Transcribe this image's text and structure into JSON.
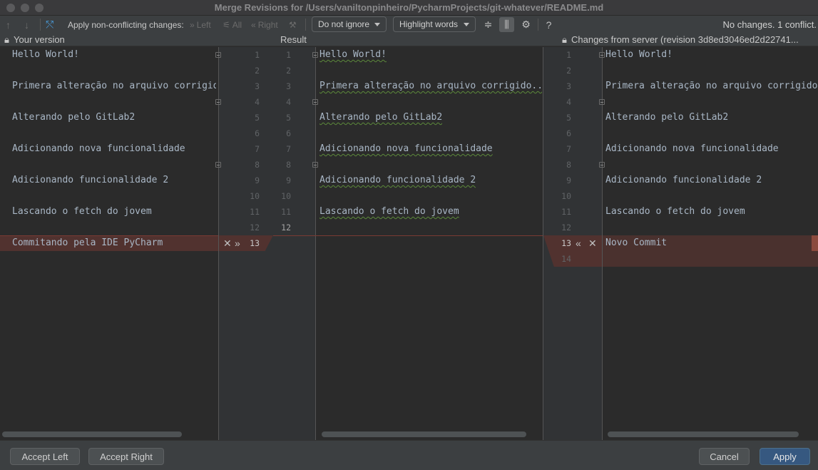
{
  "window": {
    "title": "Merge Revisions for /Users/vaniltonpinheiro/PycharmProjects/git-whatever/README.md"
  },
  "toolbar": {
    "apply_label": "Apply non-conflicting changes:",
    "left_label": "Left",
    "all_label": "All",
    "right_label": "Right",
    "ignore_select": "Do not ignore",
    "highlight_select": "Highlight words",
    "help": "?",
    "status": "No changes. 1 conflict."
  },
  "headers": {
    "left": "Your version",
    "center": "Result",
    "right": "Changes from server (revision 3d8ed3046ed2d22741..."
  },
  "left_lines": [
    "Hello World!",
    "",
    "Primera alteração no arquivo corrigido...",
    "",
    "Alterando pelo GitLab2",
    "",
    "Adicionando nova funcionalidade",
    "",
    "Adicionando funcionalidade 2",
    "",
    "Lascando o fetch do jovem",
    "",
    "Commitando pela IDE PyCharm"
  ],
  "result_lines": [
    "Hello World!",
    "",
    "Primera alteração no arquivo corrigido...",
    "",
    "Alterando pelo GitLab2",
    "",
    "Adicionando nova funcionalidade",
    "",
    "Adicionando funcionalidade 2",
    "",
    "Lascando o fetch do jovem",
    ""
  ],
  "right_lines": [
    "Hello World!",
    "",
    "Primera alteração no arquivo corrigido...",
    "",
    "Alterando pelo GitLab2",
    "",
    "Adicionando nova funcionalidade",
    "",
    "Adicionando funcionalidade 2",
    "",
    "Lascando o fetch do jovem",
    "",
    "Novo Commit",
    ""
  ],
  "line_numbers": {
    "left": [
      "1",
      "2",
      "3",
      "4",
      "5",
      "6",
      "7",
      "8",
      "9",
      "10",
      "11",
      "12",
      "13"
    ],
    "result_a": [
      "1",
      "2",
      "3",
      "4",
      "5",
      "6",
      "7",
      "8",
      "9",
      "10",
      "11",
      "12"
    ],
    "result_b": [
      "1",
      "2",
      "3",
      "4",
      "5",
      "6",
      "7",
      "8",
      "9",
      "10",
      "11",
      "12"
    ],
    "right": [
      "1",
      "2",
      "3",
      "4",
      "5",
      "6",
      "7",
      "8",
      "9",
      "10",
      "11",
      "12",
      "13",
      "14"
    ]
  },
  "buttons": {
    "accept_left": "Accept Left",
    "accept_right": "Accept Right",
    "cancel": "Cancel",
    "apply": "Apply"
  },
  "colors": {
    "conflict": "#51322f",
    "primary_button": "#365880"
  }
}
